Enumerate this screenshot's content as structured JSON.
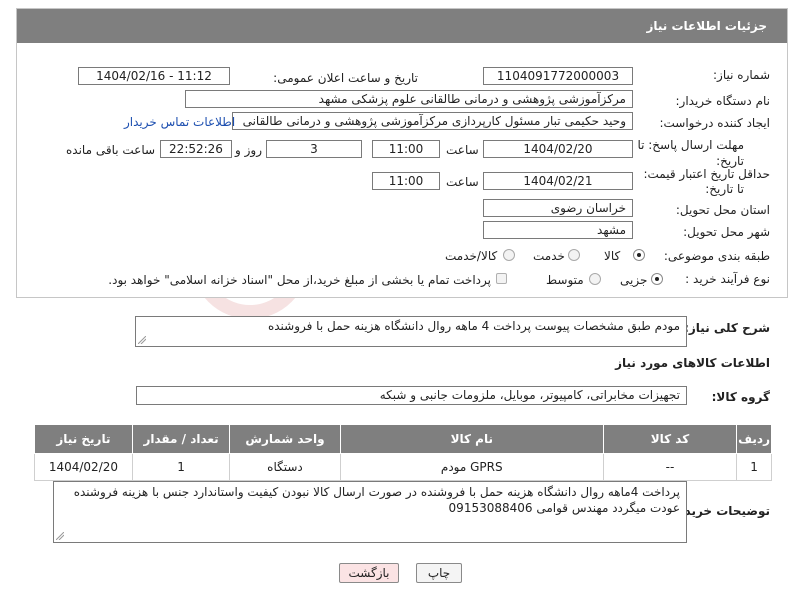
{
  "header": {
    "title": "جزئیات اطلاعات نیاز"
  },
  "fields": {
    "need_number_label": "شماره نیاز:",
    "need_number": "1104091772000003",
    "announce_label": "تاریخ و ساعت اعلان عمومی:",
    "announce_value": "1404/02/16 - 11:12",
    "buyer_label": "نام دستگاه خریدار:",
    "buyer_value": "مرکزآموزشی  پژوهشی و درمانی طالقانی   علوم پزشکی مشهد",
    "creator_label": "ایجاد کننده درخواست:",
    "creator_value": "وحید حکیمی تبار مسئول کارپردازی مرکزآموزشی  پژوهشی و درمانی طالقانی",
    "contact_link": "اطلاعات تماس خریدار",
    "deadline_label_1": "مهلت ارسال پاسخ: تا",
    "deadline_label_2": "تاریخ:",
    "deadline_date": "1404/02/20",
    "time_word": "ساعت",
    "deadline_time": "11:00",
    "days_value": "3",
    "days_word": "روز و",
    "remaining_time": "22:52:26",
    "remaining_word": "ساعت باقی مانده",
    "validity_label_1": "حداقل تاریخ اعتبار قیمت:",
    "validity_label_2": "تا تاریخ:",
    "validity_date": "1404/02/21",
    "validity_time": "11:00",
    "province_label": "استان محل تحویل:",
    "province_value": "خراسان رضوی",
    "city_label": "شهر محل تحویل:",
    "city_value": "مشهد",
    "category_label": "طبقه بندی موضوعی:",
    "category_options": [
      "کالا",
      "خدمت",
      "کالا/خدمت"
    ],
    "process_label": "نوع فرآیند خرید :",
    "process_options": [
      "جزیی",
      "متوسط"
    ],
    "payment_note": "پرداخت تمام یا بخشی از مبلغ خرید،از محل \"اسناد خزانه اسلامی\" خواهد بود."
  },
  "description": {
    "label": "شرح کلی نیاز:",
    "value": "مودم طبق مشخصات پیوست پرداخت 4 ماهه روال دانشگاه هزینه حمل با فروشنده"
  },
  "goods_section": {
    "title": "اطلاعات کالاهای مورد نیاز",
    "group_label": "گروه کالا:",
    "group_value": "تجهیزات مخابراتی، کامپیوتر، موبایل، ملزومات جانبی و شبکه",
    "columns": [
      "ردیف",
      "کد کالا",
      "نام کالا",
      "واحد شمارش",
      "تعداد / مقدار",
      "تاریخ نیاز"
    ],
    "rows": [
      {
        "row": "1",
        "code": "--",
        "name": "مودم GPRS",
        "unit": "دستگاه",
        "qty": "1",
        "date": "1404/02/20"
      }
    ]
  },
  "buyer_notes": {
    "label": "توضیحات خریدار:",
    "line1": "پرداخت 4ماهه روال دانشگاه هزینه حمل با فروشنده در صورت ارسال کالا نبودن کیفیت واستاندارد جنس با هزینه فروشنده",
    "line2": "عودت میگردد مهندس قوامی 09153088406"
  },
  "buttons": {
    "print": "چاپ",
    "back": "بازگشت"
  },
  "colors": {
    "header_bg": "#7f7f7f",
    "link": "#1d4fb0",
    "back_button_bg": "#fbe3e4"
  }
}
